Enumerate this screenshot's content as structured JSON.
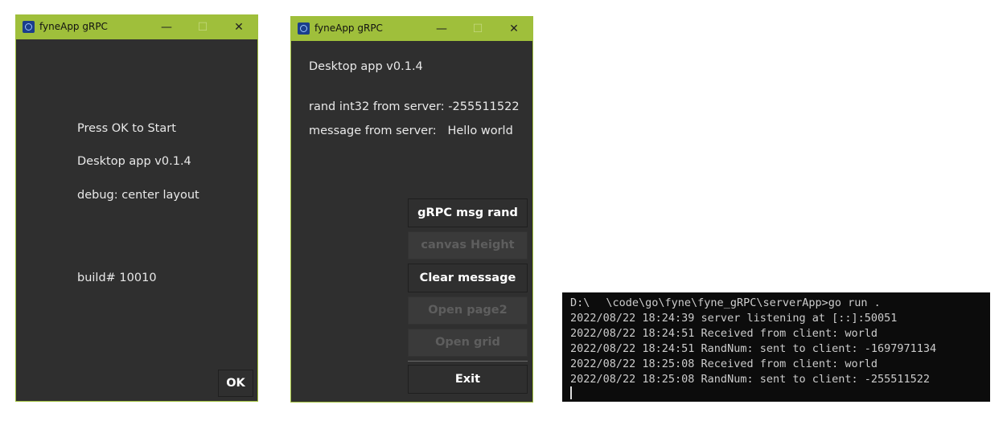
{
  "window1": {
    "title": "fyneApp gRPC",
    "labels": {
      "press_ok": "Press OK to Start",
      "version": "Desktop app v0.1.4",
      "debug": "debug: center layout",
      "build": "build# 10010"
    },
    "ok_button": "OK"
  },
  "window2": {
    "title": "fyneApp gRPC",
    "version": "Desktop app v0.1.4",
    "rand_text": "rand int32 from server: -255511522",
    "message_text": "message from server:   Hello world",
    "buttons": {
      "grpc_msg_rand": "gRPC msg rand",
      "canvas_height": "canvas Height",
      "clear_message": "Clear message",
      "open_page2": "Open page2",
      "open_grid": "Open grid",
      "exit": "Exit"
    }
  },
  "window_controls": {
    "minimize": "—",
    "maximize": "☐",
    "close": "✕"
  },
  "terminal": {
    "prompt_drive": "D:\\",
    "prompt_path": "\\code\\go\\fyne\\fyne_gRPC\\serverApp>go run .",
    "lines": [
      "2022/08/22 18:24:39 server listening at [::]:50051",
      "2022/08/22 18:24:51 Received from client: world",
      "2022/08/22 18:24:51 RandNum: sent to client: -1697971134",
      "2022/08/22 18:25:08 Received from client: world",
      "2022/08/22 18:25:08 RandNum: sent to client: -255511522"
    ]
  },
  "colors": {
    "titlebar": "#9fbf3b",
    "window_bg": "#2f2f2f",
    "terminal_bg": "#0c0c0c"
  }
}
